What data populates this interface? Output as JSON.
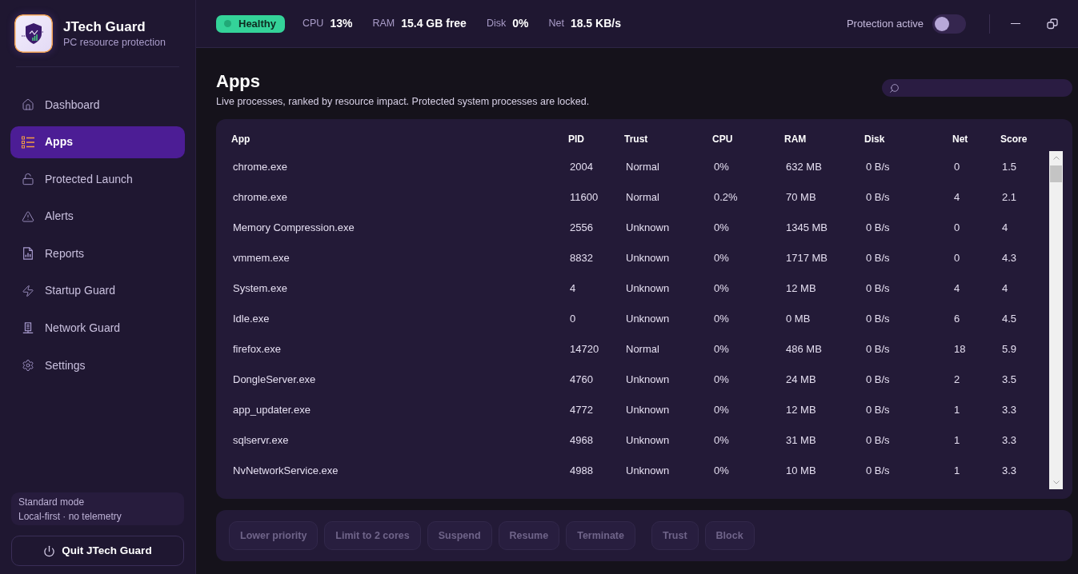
{
  "app": {
    "name": "JTech Guard",
    "tagline": "PC resource protection"
  },
  "sidebar": {
    "items": [
      {
        "label": "Dashboard",
        "selected": false
      },
      {
        "label": "Apps",
        "selected": true
      },
      {
        "label": "Protected Launch",
        "selected": false
      },
      {
        "label": "Alerts",
        "selected": false
      },
      {
        "label": "Reports",
        "selected": false
      },
      {
        "label": "Startup Guard",
        "selected": false
      },
      {
        "label": "Network Guard",
        "selected": false
      },
      {
        "label": "Settings",
        "selected": false
      }
    ],
    "mode_card": {
      "mode": "Standard mode",
      "note": "Local-first · no telemetry"
    },
    "quit_button": "Quit JTech Guard"
  },
  "status_bar": {
    "health": {
      "label": "Healthy",
      "kind": "ok"
    },
    "metrics": [
      {
        "label": "CPU",
        "value": "13%"
      },
      {
        "label": "RAM",
        "value": "15.4 GB free"
      },
      {
        "label": "Disk",
        "value": "0%"
      },
      {
        "label": "Net",
        "value": "18.5 KB/s"
      }
    ],
    "protection": {
      "label": "Protection active",
      "on": false
    }
  },
  "page": {
    "title": "Apps",
    "subtitle": "Live processes, ranked by resource impact. Protected system processes are locked."
  },
  "table": {
    "columns": [
      "App",
      "PID",
      "Trust",
      "CPU",
      "RAM",
      "Disk",
      "Net",
      "Score"
    ],
    "rows": [
      [
        "chrome.exe",
        "2004",
        "Normal",
        "0%",
        "632 MB",
        "0 B/s",
        "0",
        "1.5"
      ],
      [
        "chrome.exe",
        "11600",
        "Normal",
        "0.2%",
        "70 MB",
        "0 B/s",
        "4",
        "2.1"
      ],
      [
        "Memory Compression.exe",
        "2556",
        "Unknown",
        "0%",
        "1345 MB",
        "0 B/s",
        "0",
        "4"
      ],
      [
        "vmmem.exe",
        "8832",
        "Unknown",
        "0%",
        "1717 MB",
        "0 B/s",
        "0",
        "4.3"
      ],
      [
        "System.exe",
        "4",
        "Unknown",
        "0%",
        "12 MB",
        "0 B/s",
        "4",
        "4"
      ],
      [
        "Idle.exe",
        "0",
        "Unknown",
        "0%",
        "0 MB",
        "0 B/s",
        "6",
        "4.5"
      ],
      [
        "firefox.exe",
        "14720",
        "Normal",
        "0%",
        "486 MB",
        "0 B/s",
        "18",
        "5.9"
      ],
      [
        "DongleServer.exe",
        "4760",
        "Unknown",
        "0%",
        "24 MB",
        "0 B/s",
        "2",
        "3.5"
      ],
      [
        "app_updater.exe",
        "4772",
        "Unknown",
        "0%",
        "12 MB",
        "0 B/s",
        "1",
        "3.3"
      ],
      [
        "sqlservr.exe",
        "4968",
        "Unknown",
        "0%",
        "31 MB",
        "0 B/s",
        "1",
        "3.3"
      ],
      [
        "NvNetworkService.exe",
        "4988",
        "Unknown",
        "0%",
        "10 MB",
        "0 B/s",
        "1",
        "3.3"
      ]
    ]
  },
  "action_groups": [
    [
      {
        "label": "Lower priority",
        "disabled": true
      },
      {
        "label": "Limit to 2 cores",
        "disabled": true
      },
      {
        "label": "Suspend",
        "disabled": true
      },
      {
        "label": "Resume",
        "disabled": true
      },
      {
        "label": "Terminate",
        "disabled": true
      }
    ],
    [
      {
        "label": "Trust",
        "disabled": true
      },
      {
        "label": "Block",
        "disabled": true
      }
    ]
  ]
}
